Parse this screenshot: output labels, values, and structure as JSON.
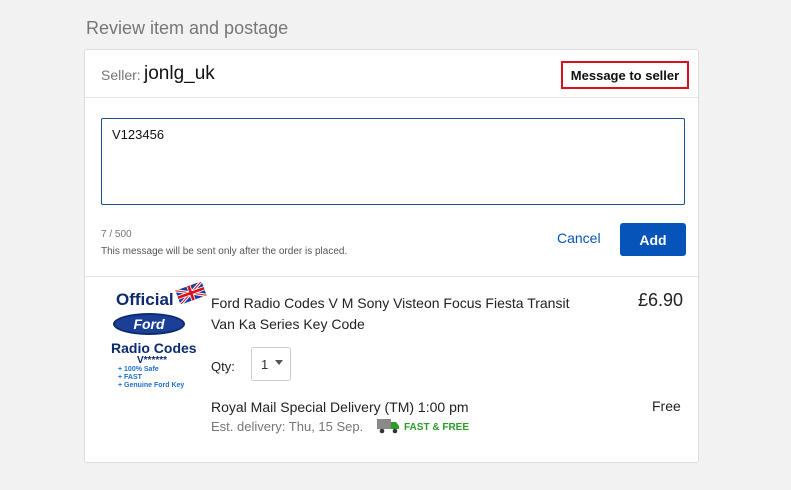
{
  "section_title": "Review item and postage",
  "seller": {
    "label": "Seller:",
    "name": "jonlg_uk",
    "message_link": "Message to seller"
  },
  "message": {
    "value": "V123456",
    "char_count": "7 / 500",
    "note": "This message will be sent only after the order is placed.",
    "cancel_label": "Cancel",
    "add_label": "Add"
  },
  "item": {
    "image": {
      "official": "Official",
      "brand": "Ford",
      "radio_codes": "Radio Codes",
      "v_code": "V******",
      "features": [
        "+ 100% Safe",
        "+ FAST",
        "+ Genuine Ford Key"
      ]
    },
    "title": "Ford Radio Codes V M Sony Visteon Focus Fiesta Transit Van Ka Series Key Code",
    "price": "£6.90",
    "qty_label": "Qty:",
    "qty_value": "1",
    "delivery_service": "Royal Mail Special Delivery (TM) 1:00 pm",
    "delivery_price": "Free",
    "est_delivery": "Est. delivery: Thu, 15 Sep.",
    "fast_free": "FAST & FREE"
  },
  "colors": {
    "accent": "#0654ba",
    "highlight_border": "#d9101b",
    "fast_free": "#2a9d2a"
  }
}
